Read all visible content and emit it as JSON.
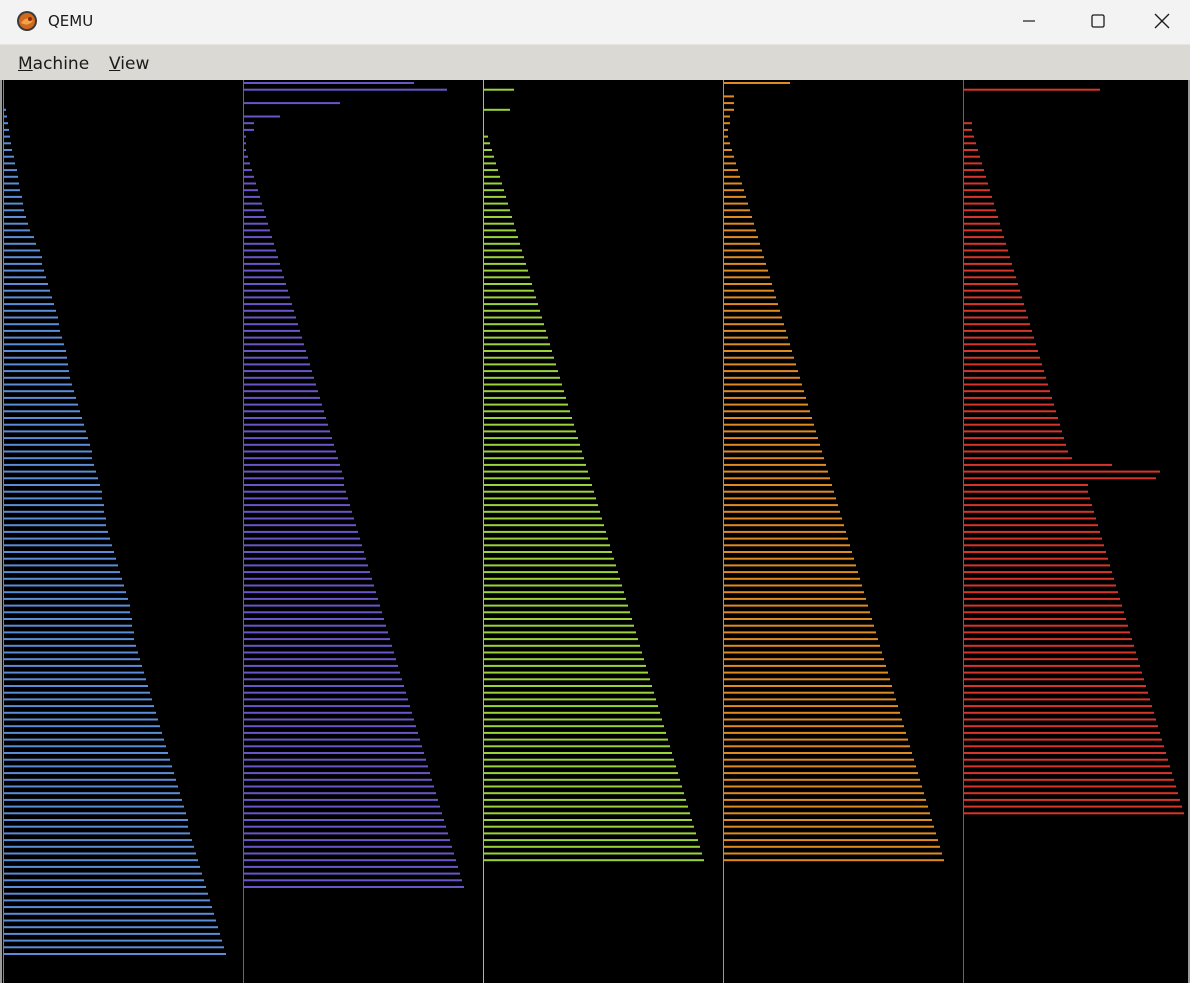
{
  "window": {
    "title": "QEMU",
    "icon": "qemu-logo-icon",
    "controls": {
      "minimize_icon": "minimize-icon",
      "maximize_icon": "maximize-icon",
      "close_icon": "close-icon"
    }
  },
  "menubar": {
    "items": [
      {
        "mnemonic": "M",
        "rest": "achine"
      },
      {
        "mnemonic": "V",
        "rest": "iew"
      }
    ]
  },
  "screen": {
    "background": "#000000",
    "description_colors": {
      "blue": "#5b8cd8",
      "purple": "#6a55c8",
      "green": "#9ad43a",
      "orange": "#e08a22",
      "red": "#d8352a"
    },
    "columns": [
      {
        "color": "#5b8cd8",
        "values": [
          0,
          0,
          0,
          0,
          2,
          3,
          4,
          5,
          6,
          7,
          8,
          10,
          11,
          13,
          14,
          15,
          16,
          18,
          19,
          20,
          22,
          24,
          26,
          30,
          32,
          36,
          38,
          38,
          40,
          42,
          44,
          46,
          48,
          50,
          52,
          54,
          55,
          56,
          58,
          60,
          62,
          63,
          64,
          65,
          66,
          68,
          70,
          72,
          74,
          76,
          78,
          80,
          82,
          84,
          86,
          88,
          88,
          90,
          92,
          94,
          96,
          98,
          98,
          100,
          100,
          102,
          102,
          104,
          106,
          108,
          110,
          112,
          114,
          116,
          118,
          120,
          122,
          124,
          126,
          126,
          128,
          128,
          130,
          130,
          132,
          134,
          136,
          138,
          140,
          142,
          144,
          146,
          148,
          150,
          152,
          154,
          156,
          158,
          160,
          162,
          164,
          166,
          168,
          170,
          172,
          174,
          176,
          178,
          180,
          182,
          184,
          184,
          186,
          188,
          190,
          192,
          194,
          196,
          198,
          200,
          202,
          204,
          206,
          208,
          210,
          212,
          214,
          216,
          218,
          220,
          222
        ]
      },
      {
        "color": "#6a55c8",
        "values": [
          170,
          203,
          0,
          96,
          0,
          36,
          10,
          10,
          2,
          2,
          2,
          4,
          6,
          8,
          10,
          12,
          14,
          16,
          18,
          20,
          22,
          24,
          26,
          28,
          30,
          32,
          34,
          36,
          38,
          40,
          42,
          44,
          46,
          48,
          50,
          52,
          54,
          56,
          58,
          60,
          62,
          64,
          66,
          68,
          70,
          72,
          74,
          76,
          78,
          80,
          82,
          84,
          86,
          88,
          90,
          92,
          94,
          96,
          98,
          100,
          100,
          102,
          104,
          106,
          108,
          110,
          112,
          114,
          116,
          118,
          120,
          122,
          124,
          126,
          128,
          130,
          132,
          134,
          136,
          138,
          140,
          142,
          144,
          146,
          148,
          150,
          152,
          154,
          156,
          158,
          160,
          162,
          164,
          166,
          168,
          170,
          172,
          174,
          176,
          178,
          180,
          182,
          184,
          186,
          188,
          190,
          192,
          194,
          196,
          198,
          200,
          202,
          204,
          206,
          208,
          210,
          212,
          214,
          216,
          218,
          220
        ]
      },
      {
        "color": "#9ad43a",
        "values": [
          0,
          30,
          0,
          0,
          26,
          0,
          0,
          0,
          4,
          6,
          8,
          10,
          12,
          14,
          16,
          18,
          20,
          22,
          24,
          26,
          28,
          30,
          32,
          34,
          36,
          38,
          40,
          42,
          44,
          46,
          48,
          50,
          52,
          54,
          56,
          58,
          60,
          62,
          64,
          66,
          68,
          70,
          72,
          74,
          76,
          78,
          80,
          82,
          84,
          86,
          88,
          90,
          92,
          94,
          96,
          98,
          100,
          102,
          104,
          106,
          108,
          110,
          112,
          114,
          116,
          118,
          120,
          122,
          124,
          126,
          128,
          130,
          132,
          134,
          136,
          138,
          140,
          142,
          144,
          146,
          148,
          150,
          152,
          154,
          156,
          158,
          160,
          162,
          164,
          166,
          168,
          170,
          172,
          174,
          176,
          178,
          180,
          182,
          184,
          186,
          188,
          190,
          192,
          194,
          196,
          198,
          200,
          202,
          204,
          206,
          208,
          210,
          212,
          214,
          216,
          218,
          220
        ]
      },
      {
        "color": "#e08a22",
        "values": [
          66,
          0,
          10,
          10,
          10,
          6,
          6,
          4,
          4,
          6,
          8,
          10,
          12,
          14,
          16,
          18,
          20,
          22,
          24,
          26,
          28,
          30,
          32,
          34,
          36,
          38,
          40,
          42,
          44,
          46,
          48,
          50,
          52,
          54,
          56,
          58,
          60,
          62,
          64,
          66,
          68,
          70,
          72,
          74,
          76,
          78,
          80,
          82,
          84,
          86,
          88,
          90,
          92,
          94,
          96,
          98,
          100,
          102,
          104,
          106,
          108,
          110,
          112,
          114,
          116,
          118,
          120,
          122,
          124,
          126,
          128,
          130,
          132,
          134,
          136,
          138,
          140,
          142,
          144,
          146,
          148,
          150,
          152,
          154,
          156,
          158,
          160,
          162,
          164,
          166,
          168,
          170,
          172,
          174,
          176,
          178,
          180,
          182,
          184,
          186,
          188,
          190,
          192,
          194,
          196,
          198,
          200,
          202,
          204,
          206,
          208,
          210,
          212,
          214,
          216,
          218,
          220
        ]
      },
      {
        "color": "#d8352a",
        "values": [
          0,
          136,
          0,
          0,
          0,
          0,
          8,
          8,
          10,
          12,
          14,
          16,
          18,
          20,
          22,
          24,
          26,
          28,
          30,
          32,
          34,
          36,
          38,
          40,
          42,
          44,
          46,
          48,
          50,
          52,
          54,
          56,
          58,
          60,
          62,
          64,
          66,
          68,
          70,
          72,
          74,
          76,
          78,
          80,
          82,
          84,
          86,
          88,
          90,
          92,
          94,
          96,
          98,
          100,
          102,
          104,
          108,
          148,
          196,
          192,
          124,
          124,
          126,
          128,
          130,
          132,
          134,
          136,
          138,
          140,
          142,
          144,
          146,
          148,
          150,
          152,
          154,
          156,
          158,
          160,
          162,
          164,
          166,
          168,
          170,
          172,
          174,
          176,
          178,
          180,
          182,
          184,
          186,
          188,
          190,
          192,
          194,
          196,
          198,
          200,
          202,
          204,
          206,
          208,
          210,
          212,
          214,
          216,
          218,
          220
        ]
      }
    ]
  }
}
